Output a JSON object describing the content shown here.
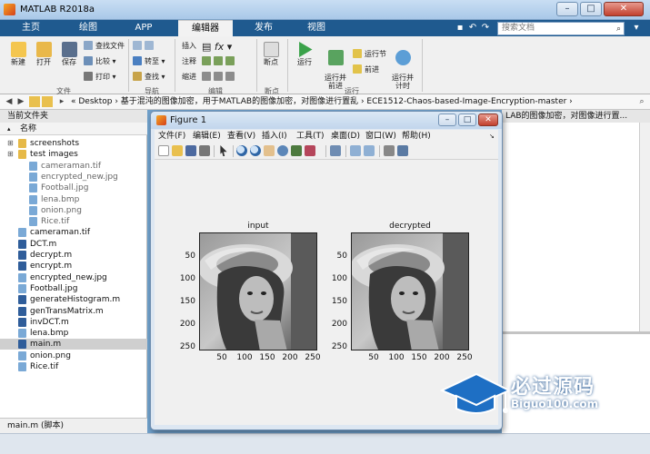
{
  "window": {
    "title": "MATLAB R2018a"
  },
  "tabs": [
    {
      "label": "主页"
    },
    {
      "label": "绘图"
    },
    {
      "label": "APP"
    },
    {
      "label": "编辑器"
    },
    {
      "label": "发布"
    },
    {
      "label": "视图"
    }
  ],
  "search": {
    "placeholder": "搜索文档"
  },
  "ribbon": {
    "new": "新建",
    "open": "打开",
    "save": "保存",
    "find_files": "查找文件",
    "compare": "比较",
    "print": "打印",
    "goto": "转至",
    "find": "查找",
    "insert": "插入",
    "comment": "注释",
    "indent": "缩进",
    "breakpoints": "断点",
    "run": "运行",
    "run_advance": "运行并\n前进",
    "run_section": "运行节",
    "advance": "前进",
    "run_time": "运行并\n计时",
    "groups": {
      "file": "文件",
      "navigate": "导航",
      "edit": "编辑",
      "breakpoints": "断点",
      "run": "运行"
    }
  },
  "address": {
    "path": "« Desktop › 基于混沌的图像加密，用于MATLAB的图像加密，对图像进行置乱 › ECE1512-Chaos-based-Image-Encryption-master ›"
  },
  "left_panel": {
    "header": "当前文件夹",
    "column": "名称",
    "items": [
      {
        "name": "screenshots",
        "type": "folder",
        "indent": 0,
        "dim": false
      },
      {
        "name": "test images",
        "type": "folder",
        "indent": 0,
        "dim": false
      },
      {
        "name": "cameraman.tif",
        "type": "img",
        "indent": 1,
        "dim": true
      },
      {
        "name": "encrypted_new.jpg",
        "type": "img",
        "indent": 1,
        "dim": true
      },
      {
        "name": "Football.jpg",
        "type": "img",
        "indent": 1,
        "dim": true
      },
      {
        "name": "lena.bmp",
        "type": "img",
        "indent": 1,
        "dim": true
      },
      {
        "name": "onion.png",
        "type": "img",
        "indent": 1,
        "dim": true
      },
      {
        "name": "Rice.tif",
        "type": "img",
        "indent": 1,
        "dim": true
      },
      {
        "name": "cameraman.tif",
        "type": "img",
        "indent": 0,
        "dim": false
      },
      {
        "name": "DCT.m",
        "type": "m",
        "indent": 0,
        "dim": false
      },
      {
        "name": "decrypt.m",
        "type": "m",
        "indent": 0,
        "dim": false
      },
      {
        "name": "encrypt.m",
        "type": "m",
        "indent": 0,
        "dim": false
      },
      {
        "name": "encrypted_new.jpg",
        "type": "img",
        "indent": 0,
        "dim": false
      },
      {
        "name": "Football.jpg",
        "type": "img",
        "indent": 0,
        "dim": false
      },
      {
        "name": "generateHistogram.m",
        "type": "m",
        "indent": 0,
        "dim": false
      },
      {
        "name": "genTransMatrix.m",
        "type": "m",
        "indent": 0,
        "dim": false
      },
      {
        "name": "invDCT.m",
        "type": "m",
        "indent": 0,
        "dim": false
      },
      {
        "name": "lena.bmp",
        "type": "img",
        "indent": 0,
        "dim": false
      },
      {
        "name": "main.m",
        "type": "m",
        "indent": 0,
        "dim": false,
        "selected": true
      },
      {
        "name": "onion.png",
        "type": "img",
        "indent": 0,
        "dim": false
      },
      {
        "name": "Rice.tif",
        "type": "img",
        "indent": 0,
        "dim": false
      }
    ],
    "status": "main.m  (脚本)"
  },
  "editor": {
    "tab_text": "LAB的图像加密，对图像进行置..."
  },
  "figure": {
    "title": "Figure 1",
    "menu": [
      "文件(F)",
      "编辑(E)",
      "查看(V)",
      "插入(I)",
      "工具(T)",
      "桌面(D)",
      "窗口(W)",
      "帮助(H)"
    ],
    "axes": [
      {
        "title": "input",
        "yticks": [
          "50",
          "100",
          "150",
          "200",
          "250"
        ],
        "xticks": [
          "50",
          "100",
          "150",
          "200",
          "250"
        ]
      },
      {
        "title": "decrypted",
        "yticks": [
          "50",
          "100",
          "150",
          "200",
          "250"
        ],
        "xticks": [
          "50",
          "100",
          "150",
          "200",
          "250"
        ]
      }
    ]
  },
  "watermark": {
    "text": "必过源码",
    "url": "Biguo100.com"
  }
}
